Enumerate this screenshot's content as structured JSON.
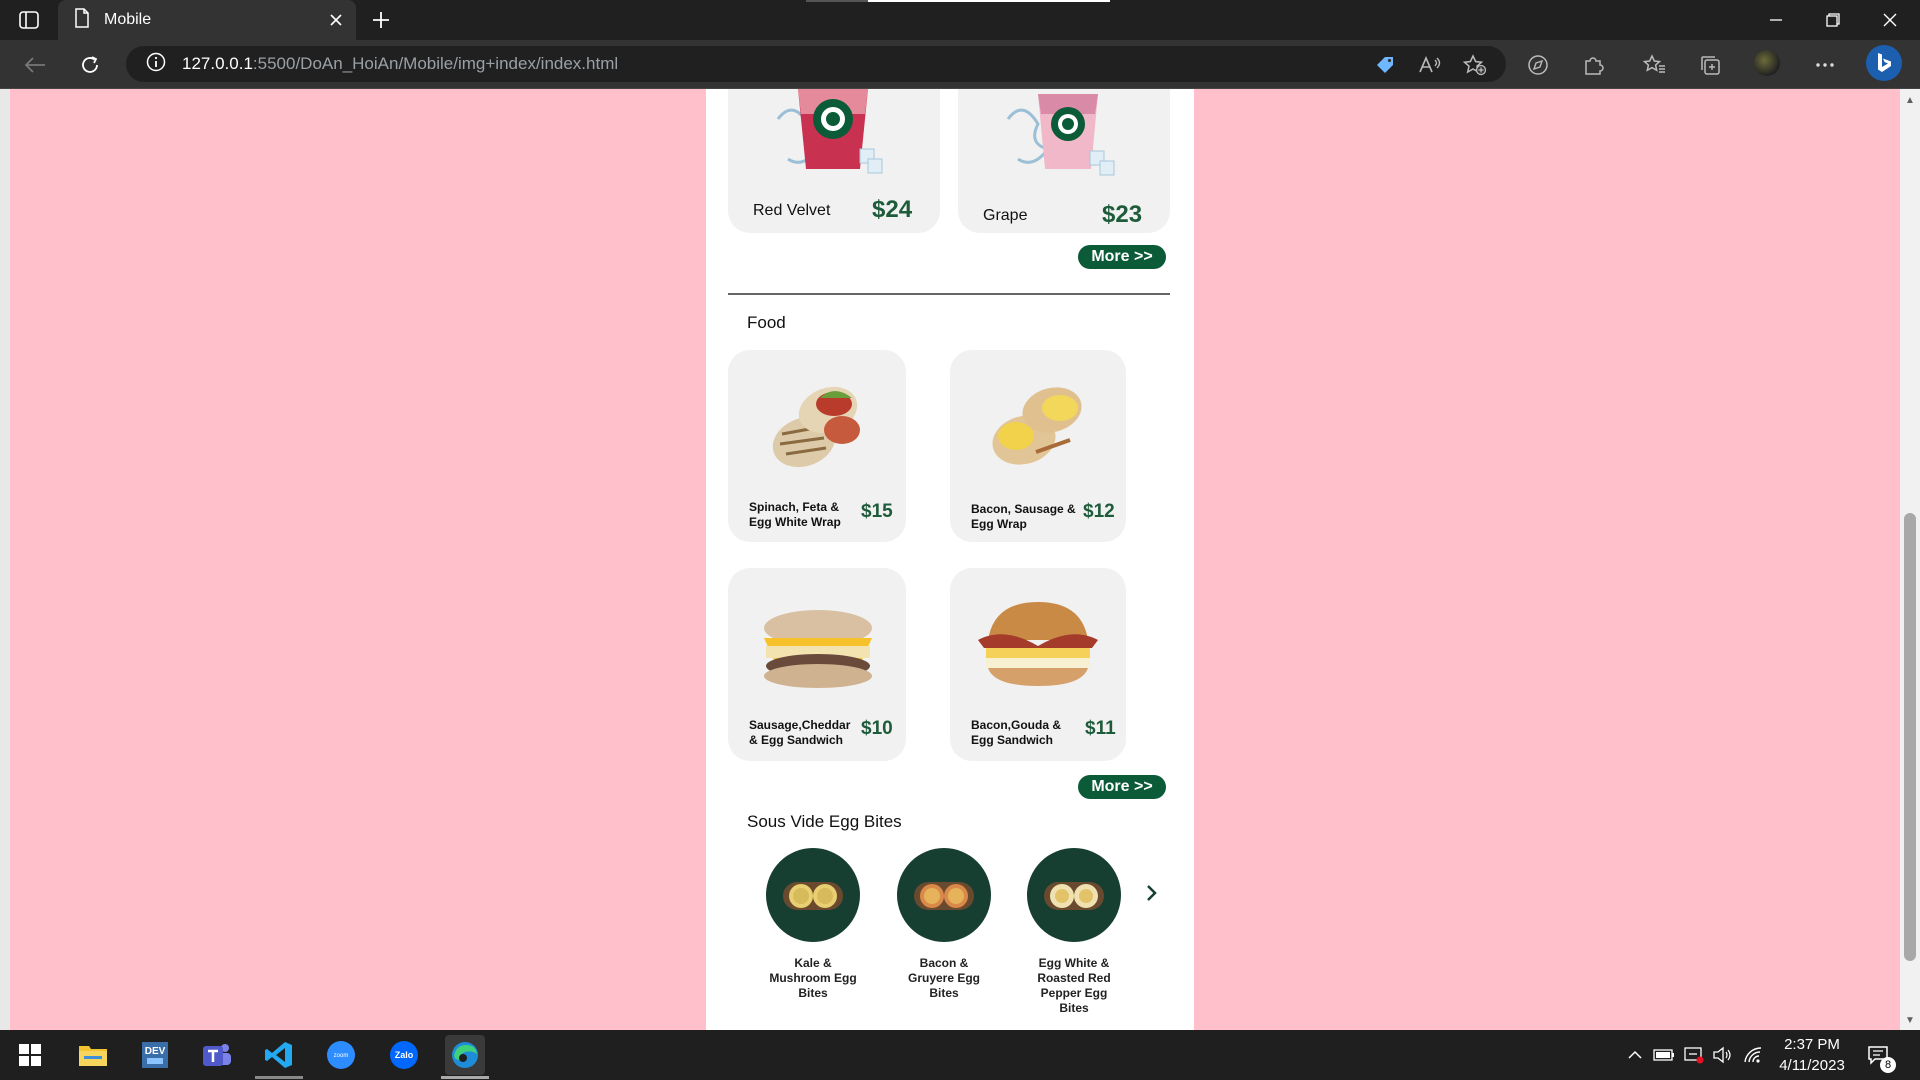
{
  "browser": {
    "tab_title": "Mobile",
    "url_host": "127.0.0.1",
    "url_rest": ":5500/DoAn_HoiAn/Mobile/img+index/index.html"
  },
  "drinks": [
    {
      "name": "Red Velvet",
      "price": "$24"
    },
    {
      "name": "Grape",
      "price": "$23"
    }
  ],
  "more_label": "More >>",
  "food": {
    "title": "Food",
    "items": [
      {
        "name_line1": "Spinach, Feta &",
        "name_line2": "Egg White Wrap",
        "price": "$15"
      },
      {
        "name_line1": "Bacon, Sausage &",
        "name_line2": "Egg Wrap",
        "price": "$12"
      },
      {
        "name_line1": "Sausage,Cheddar",
        "name_line2": "& Egg Sandwich",
        "price": "$10"
      },
      {
        "name_line1": "Bacon,Gouda &",
        "name_line2": "Egg Sandwich",
        "price": "$11"
      }
    ]
  },
  "egg_bites": {
    "title": "Sous Vide Egg Bites",
    "items": [
      {
        "line1": "Kale &",
        "line2": "Mushroom Egg",
        "line3": "Bites"
      },
      {
        "line1": "Bacon &",
        "line2": "Gruyere Egg",
        "line3": "Bites"
      },
      {
        "line1": "Egg White &",
        "line2": "Roasted Red",
        "line3": "Pepper Egg",
        "line4": "Bites"
      }
    ]
  },
  "taskbar": {
    "time": "2:37 PM",
    "date": "4/11/2023",
    "notification_count": "8",
    "apps": [
      "start-icon",
      "file-explorer-icon",
      "devhome-icon",
      "teams-icon",
      "vscode-icon",
      "zoom-icon",
      "zalo-icon",
      "edge-icon"
    ],
    "zoom_label": "zoom",
    "zalo_label": "Zalo",
    "dev_label": "DEV"
  },
  "colors": {
    "page_bg": "#ffc0cb",
    "brand_green": "#1e5b3a",
    "button_green": "#0b5a38"
  }
}
